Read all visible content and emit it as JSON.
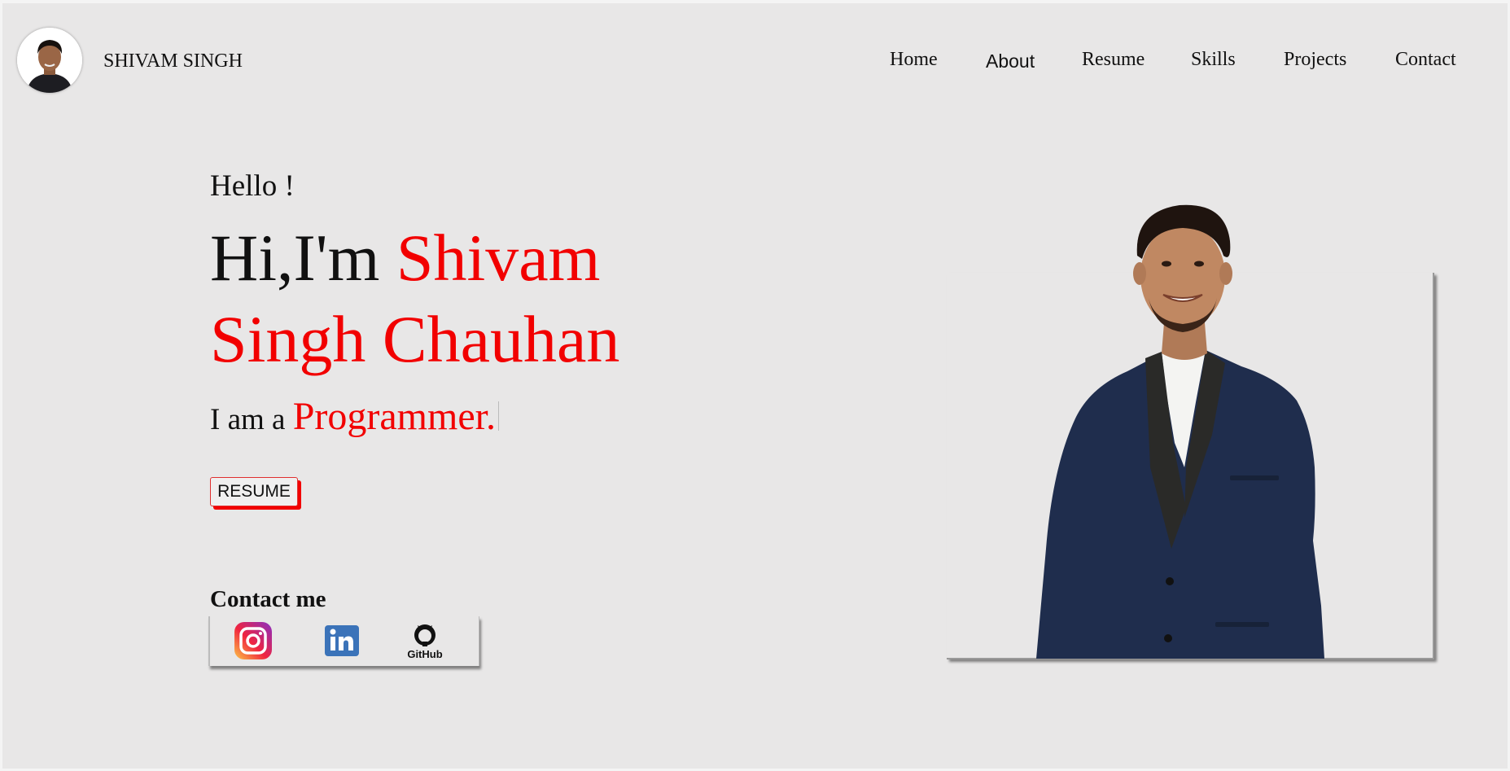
{
  "header": {
    "brand": "SHIVAM SINGH",
    "nav": [
      "Home",
      "About",
      "Resume",
      "Skills",
      "Projects",
      "Contact"
    ]
  },
  "hero": {
    "greeting": "Hello !",
    "intro": "Hi,I'm ",
    "name": "Shivam Singh Chauhan",
    "role_prefix": "I am a ",
    "role": "Programmer.",
    "resume_label": "RESUME"
  },
  "contact": {
    "title": "Contact me",
    "icons": [
      "instagram-icon",
      "linkedin-icon",
      "github-icon"
    ],
    "github_label": "GitHub"
  },
  "colors": {
    "accent": "#f20000",
    "background": "#e8e7e7",
    "linkedin": "#3b73b9",
    "suit": "#1f2d4d"
  }
}
